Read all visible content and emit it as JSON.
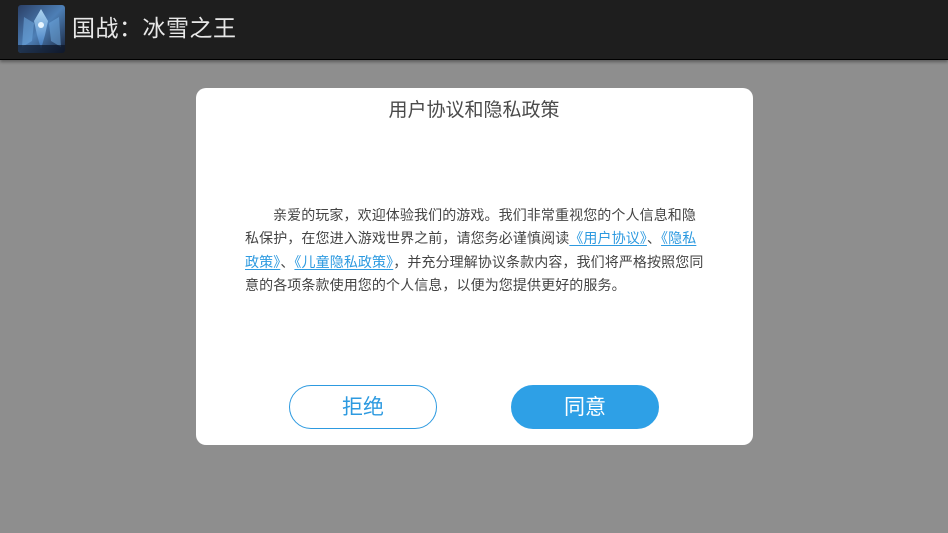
{
  "app": {
    "title": "国战：冰雪之王",
    "icon": "game-app-icon"
  },
  "dialog": {
    "title": "用户协议和隐私政策",
    "body": {
      "text_1": "亲爱的玩家，欢迎体验我们的游戏。我们非常重视您的个人信息和隐私保护，在您进入游戏世界之前，请您务必谨慎阅读",
      "link_user_agreement": "《用户协议》",
      "sep_1": "、",
      "link_privacy_policy": "《隐私政策》",
      "sep_2": "、",
      "link_child_privacy_policy": "《儿童隐私政策》",
      "text_2": "，并充分理解协议条款内容，我们将严格按照您同意的各项条款使用您的个人信息，以便为您提供更好的服务。"
    },
    "buttons": {
      "refuse_label": "拒绝",
      "agree_label": "同意"
    }
  },
  "colors": {
    "titlebar_bg": "#1e1e1e",
    "overlay_bg": "#8e8e8e",
    "dialog_bg": "#ffffff",
    "accent": "#2ea0e6",
    "link": "#2d9ae0",
    "body_text": "#444444"
  }
}
